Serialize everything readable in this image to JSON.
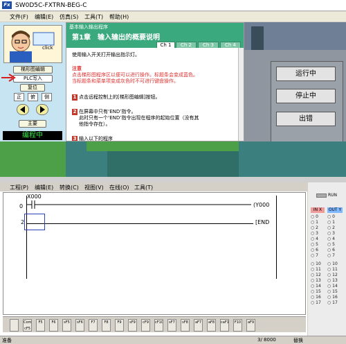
{
  "window": {
    "title": "SW0D5C-FXTRN-BEG-C",
    "logo": "Fx"
  },
  "menubar": [
    "文件(F)",
    "编辑(E)",
    "仿真(S)",
    "工具(T)",
    "帮助(H)"
  ],
  "left_panel": {
    "click_label": "click",
    "buttons": {
      "ladder_edit": "梯形图编辑",
      "plc_write": "PLC写入",
      "reset": "复位",
      "main": "主要"
    },
    "view_buttons": [
      "正",
      "俯",
      "侧"
    ],
    "status": "编程中"
  },
  "tutorial": {
    "header": "基本输入输出程序",
    "chapter": "第1章　输入输出的概要说明",
    "tabs": [
      "Ch 1",
      "Ch 2",
      "Ch 3",
      "Ch 4"
    ],
    "intro": "使用输入开关打开输出指示灯。",
    "note_title": "注意",
    "note_lines": [
      "点击梯形图程序区以便可以进行操作。标题条会变成蓝色。",
      "当标题条和菜单项变成灰色时不可进行键盘操作。"
    ],
    "steps": [
      {
        "num": "1",
        "lines": [
          "点击远程控制上的[梯形图编辑]按钮。"
        ]
      },
      {
        "num": "2",
        "lines": [
          "在屏幕中只有‘END’指令。",
          "此时只有一个‘END’指令出现在程序的起始位置（没有其",
          "他指令存在）。"
        ]
      },
      {
        "num": "3",
        "lines": [
          "输入以下的程序"
        ]
      }
    ]
  },
  "scene_buttons": [
    "运行中",
    "停止中",
    "出错"
  ],
  "ladder_menu": [
    "工程(P)",
    "编辑(E)",
    "转换(C)",
    "视图(V)",
    "在线(O)",
    "工具(T)"
  ],
  "ladder": {
    "rungs": [
      {
        "step": "0",
        "contact": "X000",
        "coil": "(Y000"
      },
      {
        "step": "2",
        "coil": "[END"
      }
    ]
  },
  "io_panel": {
    "run_label": "RUN",
    "in_label": "IN X",
    "out_label": "OUT Y",
    "in_numbers": [
      "0",
      "1",
      "2",
      "3",
      "4",
      "5",
      "6",
      "7",
      "10",
      "11",
      "12",
      "13",
      "14",
      "15",
      "16",
      "17"
    ],
    "out_numbers": [
      "0",
      "1",
      "2",
      "3",
      "4",
      "5",
      "6",
      "7",
      "10",
      "11",
      "12",
      "13",
      "14",
      "15",
      "16",
      "17"
    ]
  },
  "fkeys": [
    "",
    "Com\ncF5",
    "F5",
    "F6",
    "sF5",
    "sF6",
    "F7",
    "F8",
    "F9",
    "sF9",
    "cF9",
    "cF10",
    "sF7",
    "sF8",
    "aF7",
    "aF8",
    "caF10",
    "F10",
    "aF9"
  ],
  "statusbar": {
    "left": "准备",
    "steps": "3/ 8000",
    "mode": "替换"
  },
  "colors": {
    "status_green": "#38e848",
    "tutorial_teal": "#3aa97e",
    "note_red": "#e03030"
  }
}
